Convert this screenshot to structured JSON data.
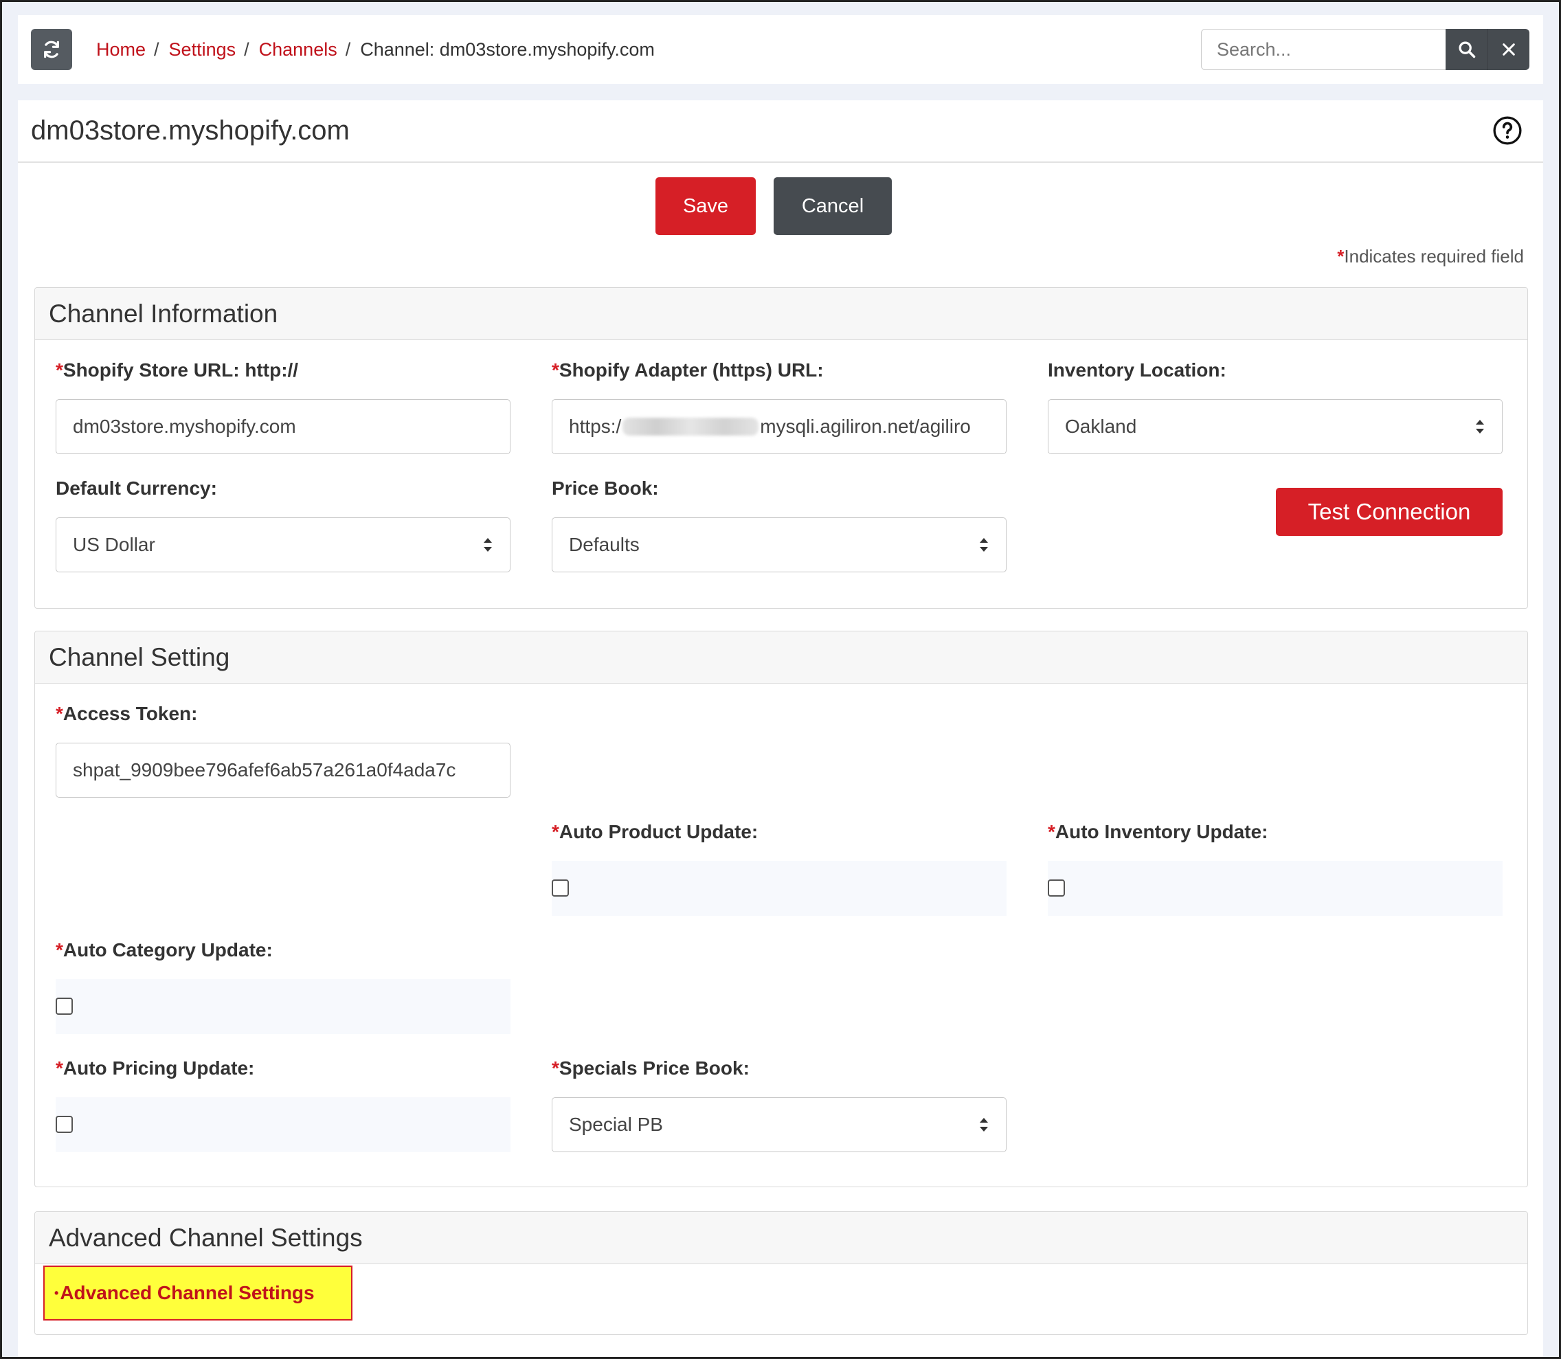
{
  "breadcrumb": {
    "home": "Home",
    "settings": "Settings",
    "channels": "Channels",
    "current": "Channel: dm03store.myshopify.com",
    "separator": "/"
  },
  "search": {
    "placeholder": "Search...",
    "value": ""
  },
  "page": {
    "title": "dm03store.myshopify.com",
    "save_label": "Save",
    "cancel_label": "Cancel",
    "required_star": "*",
    "required_note": "Indicates required field"
  },
  "channel_information": {
    "title": "Channel Information",
    "store_url_label": "Shopify Store URL: http://",
    "store_url_value": "dm03store.myshopify.com",
    "adapter_url_label": "Shopify Adapter (https) URL:",
    "adapter_url_prefix": "https:/",
    "adapter_url_suffix": "mysqli.agiliron.net/agiliro",
    "inventory_location_label": "Inventory Location:",
    "inventory_location_value": "Oakland",
    "default_currency_label": "Default Currency:",
    "default_currency_value": "US Dollar",
    "price_book_label": "Price Book:",
    "price_book_value": "Defaults",
    "test_connection_label": "Test Connection"
  },
  "channel_setting": {
    "title": "Channel Setting",
    "access_token_label": "Access Token:",
    "access_token_value": "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",
    "auto_product_update_label": "Auto Product Update:",
    "auto_product_update_checked": false,
    "auto_inventory_update_label": "Auto Inventory Update:",
    "auto_inventory_update_checked": false,
    "auto_category_update_label": "Auto Category Update:",
    "auto_category_update_checked": false,
    "auto_pricing_update_label": "Auto Pricing Update:",
    "auto_pricing_update_checked": false,
    "specials_price_book_label": "Specials Price Book:",
    "specials_price_book_value": "Special PB"
  },
  "advanced": {
    "title": "Advanced Channel Settings",
    "bullet": "•",
    "link_label": "Advanced Channel Settings",
    "highlight_color": "#ffff3b"
  },
  "colors": {
    "accent_red": "#d61f26",
    "dark_button": "#464b50",
    "link_red": "#c0121b"
  },
  "icons": [
    "refresh-icon",
    "search-icon",
    "close-icon",
    "help-icon",
    "select-arrows-icon"
  ]
}
